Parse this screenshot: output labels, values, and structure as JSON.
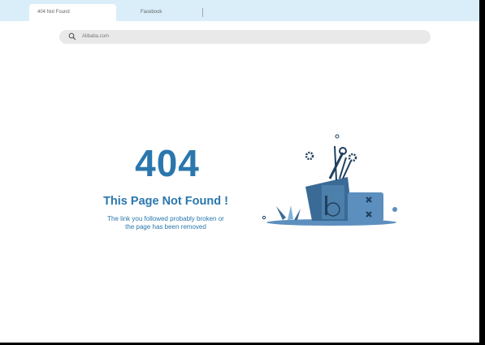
{
  "tabs": [
    {
      "label": "404 Not Found",
      "active": true
    },
    {
      "label": "Facebook",
      "active": false
    }
  ],
  "address_bar": {
    "url": "Alibaba.com",
    "icon": "search-icon"
  },
  "error": {
    "code": "404",
    "title": "This Page Not Found !",
    "description_line1": "The link you followed probably broken or",
    "description_line2": "the page has been removed"
  },
  "colors": {
    "accent": "#2a77ad",
    "tabbar": "#d9eef9",
    "illustration_dark": "#3a6a96",
    "illustration_light": "#5d8fbe"
  }
}
